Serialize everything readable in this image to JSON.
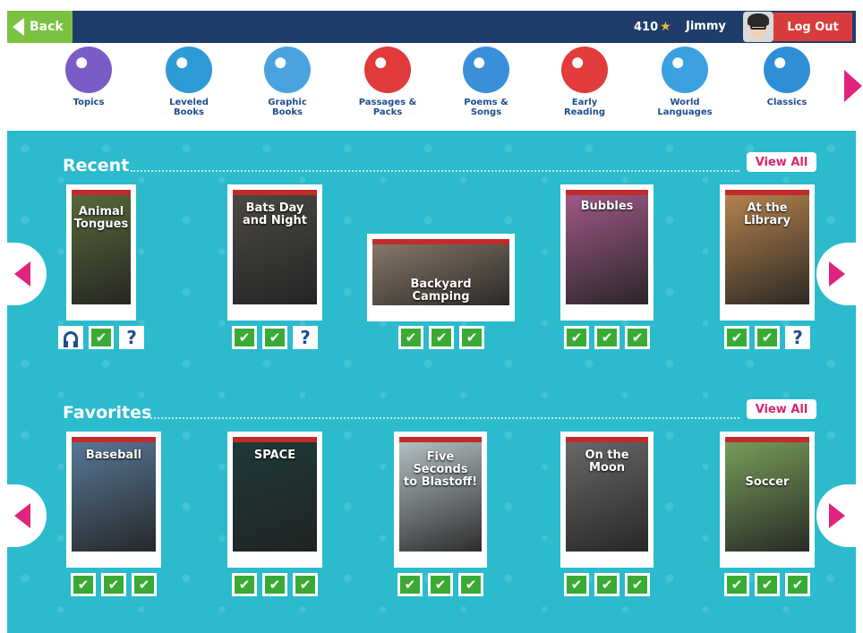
{
  "topbar": {
    "back_label": "Back",
    "stars": "410",
    "username": "Jimmy",
    "logout_label": "Log Out"
  },
  "categories": [
    {
      "label": "Topics",
      "icon": "topics-icon",
      "color": "#7b5cc6"
    },
    {
      "label": "Leveled\nBooks",
      "icon": "leveled-books-icon",
      "color": "#2e9bd6"
    },
    {
      "label": "Graphic\nBooks",
      "icon": "graphic-books-icon",
      "color": "#4aa3df"
    },
    {
      "label": "Passages &\nPacks",
      "icon": "passages-packs-icon",
      "color": "#e03a3a"
    },
    {
      "label": "Poems &\nSongs",
      "icon": "poems-songs-icon",
      "color": "#3b8fd9"
    },
    {
      "label": "Early\nReading",
      "icon": "early-reading-icon",
      "color": "#e23b3b"
    },
    {
      "label": "World\nLanguages",
      "icon": "world-languages-icon",
      "color": "#3aa0e0"
    },
    {
      "label": "Classics",
      "icon": "classics-icon",
      "color": "#2f8fd6"
    }
  ],
  "recent": {
    "title": "Recent",
    "view_all": "View All",
    "books": [
      {
        "title": "Animal\nTongues",
        "color": "#5a6b3a",
        "badges": [
          "headphones",
          "check",
          "question"
        ]
      },
      {
        "title": "Bats Day\nand Night",
        "color": "#4d4a44",
        "badges": [
          "check",
          "check",
          "question"
        ]
      },
      {
        "title": "Backyard\nCamping",
        "color": "#8a7a6a",
        "badges": [
          "check",
          "check",
          "check"
        ]
      },
      {
        "title": "Bubbles",
        "color": "#a35a8a",
        "badges": [
          "check",
          "check",
          "check"
        ]
      },
      {
        "title": "At the\nLibrary",
        "color": "#b9854e",
        "badges": [
          "check",
          "check",
          "question"
        ]
      }
    ]
  },
  "favorites": {
    "title": "Favorites",
    "view_all": "View All",
    "books": [
      {
        "title": "Baseball",
        "color": "#5a7a9a",
        "badges": [
          "check",
          "check",
          "check"
        ]
      },
      {
        "title": "SPACE",
        "color": "#1e3a3a",
        "badges": [
          "check",
          "check",
          "check"
        ]
      },
      {
        "title": "Five Seconds\nto Blastoff!",
        "color": "#b8c4c8",
        "badges": [
          "check",
          "check",
          "check"
        ]
      },
      {
        "title": "On the\nMoon",
        "color": "#6a6a6a",
        "badges": [
          "check",
          "check",
          "check"
        ]
      },
      {
        "title": "Soccer",
        "color": "#7aa05a",
        "badges": [
          "check",
          "check",
          "check"
        ]
      }
    ]
  },
  "colors": {
    "topbar": "#1f3d6b",
    "back": "#7cc242",
    "logout": "#d93c3c",
    "content_bg": "#2bbbcd",
    "accent_pink": "#e0247d",
    "check_green": "#3aaa35"
  }
}
